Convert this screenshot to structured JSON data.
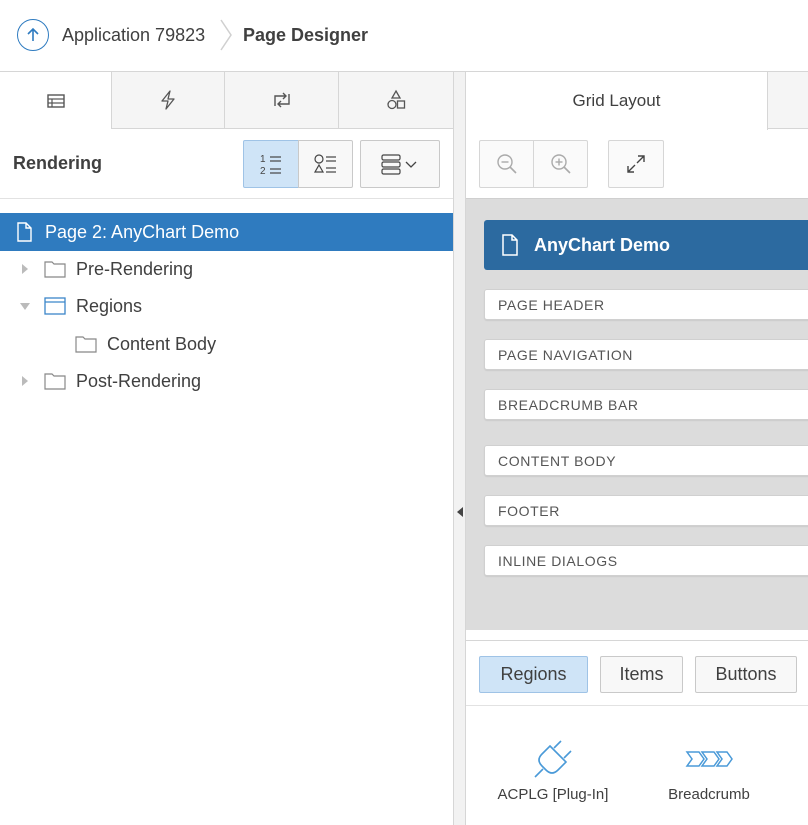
{
  "header": {
    "app_label": "Application 79823",
    "page_label": "Page Designer"
  },
  "left_tabs": [
    {
      "name": "rendering-tab",
      "icon": "tree-icon"
    },
    {
      "name": "dynamic-actions-tab",
      "icon": "lightning-icon"
    },
    {
      "name": "processing-tab",
      "icon": "swap-icon"
    },
    {
      "name": "shared-components-tab",
      "icon": "shapes-icon"
    }
  ],
  "rendering": {
    "title": "Rendering",
    "tree": {
      "page": "Page 2: AnyChart Demo",
      "pre_rendering": "Pre-Rendering",
      "regions": "Regions",
      "content_body": "Content Body",
      "post_rendering": "Post-Rendering"
    }
  },
  "grid": {
    "tab_label": "Grid Layout",
    "page_title": "AnyChart Demo",
    "slots": [
      "PAGE HEADER",
      "PAGE NAVIGATION",
      "BREADCRUMB BAR",
      "CONTENT BODY",
      "FOOTER",
      "INLINE DIALOGS"
    ]
  },
  "gallery": {
    "tabs": [
      "Regions",
      "Items",
      "Buttons"
    ],
    "items": [
      "ACPLG [Plug-In]",
      "Breadcrumb"
    ]
  },
  "colors": {
    "accent": "#2f7bbf",
    "title_bar": "#2c6aa0",
    "selected_button": "#cfe4f7"
  }
}
